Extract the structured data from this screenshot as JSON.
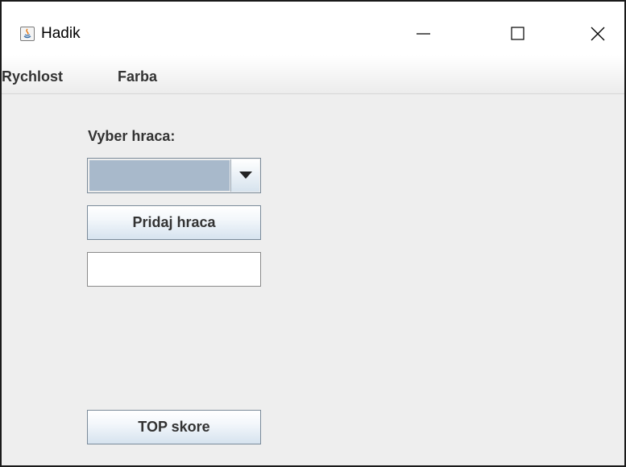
{
  "window": {
    "title": "Hadik",
    "icon": "java-icon",
    "controls": {
      "minimize": "minimize-icon",
      "maximize": "maximize-icon",
      "close": "close-icon"
    }
  },
  "menubar": {
    "items": [
      {
        "label": "Rychlost"
      },
      {
        "label": "Farba"
      }
    ]
  },
  "main": {
    "player_label": "Vyber hraca:",
    "player_select": {
      "selected": ""
    },
    "add_player_button": "Pridaj hraca",
    "name_input": {
      "value": "",
      "placeholder": ""
    },
    "top_score_button": "TOP skore"
  },
  "colors": {
    "background": "#eeeeee",
    "combo_selection": "#a8b9cb",
    "label_text": "#333333"
  }
}
